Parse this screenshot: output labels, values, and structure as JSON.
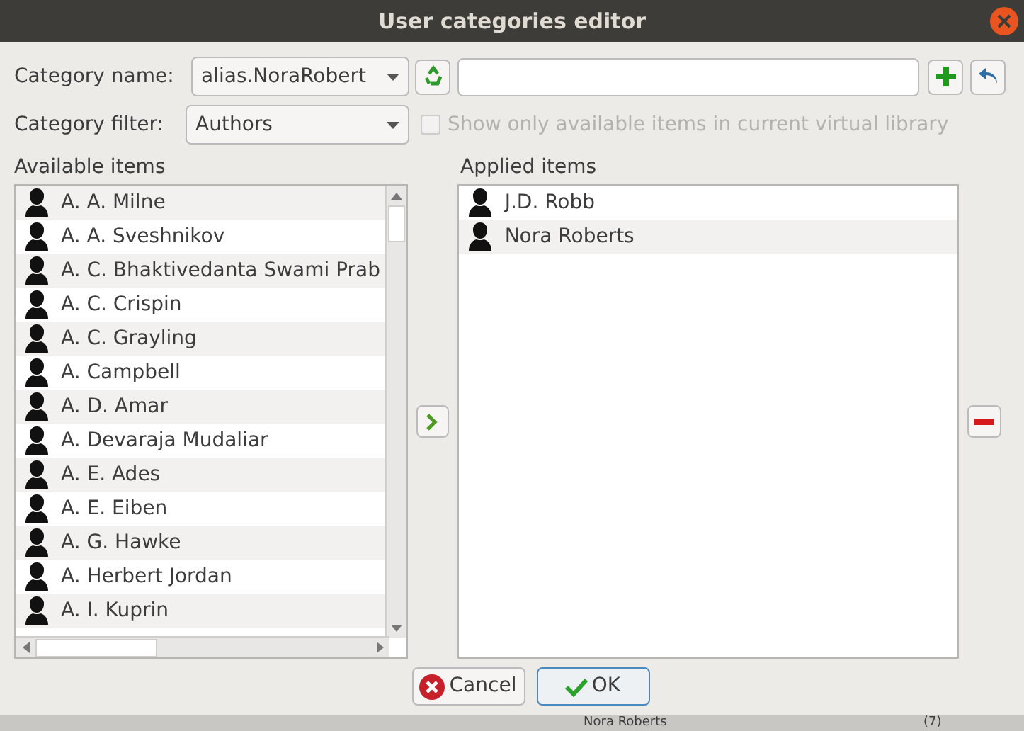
{
  "window": {
    "title": "User categories editor"
  },
  "category_name": {
    "label": "Category name:",
    "value": "alias.NoraRobert"
  },
  "category_filter": {
    "label": "Category filter:",
    "value": "Authors"
  },
  "show_only_available": {
    "label": "Show only available items in current virtual library",
    "checked": false,
    "disabled": true
  },
  "available_items": {
    "label": "Available items",
    "items": [
      {
        "name": "A. A. Milne"
      },
      {
        "name": "A. A. Sveshnikov"
      },
      {
        "name": "A. C. Bhaktivedanta Swami Prab"
      },
      {
        "name": "A. C. Crispin"
      },
      {
        "name": "A. C. Grayling"
      },
      {
        "name": "A. Campbell"
      },
      {
        "name": "A. D. Amar"
      },
      {
        "name": "A. Devaraja Mudaliar"
      },
      {
        "name": "A. E. Ades"
      },
      {
        "name": "A. E. Eiben"
      },
      {
        "name": "A. G. Hawke"
      },
      {
        "name": "A. Herbert Jordan"
      },
      {
        "name": "A. I. Kuprin"
      }
    ]
  },
  "applied_items": {
    "label": "Applied items",
    "items": [
      {
        "name": "J.D. Robb"
      },
      {
        "name": "Nora Roberts"
      }
    ]
  },
  "buttons": [
    "Cancel",
    "OK"
  ],
  "background_window": {
    "row_name": "Nora Roberts",
    "row_count": "(7)"
  }
}
